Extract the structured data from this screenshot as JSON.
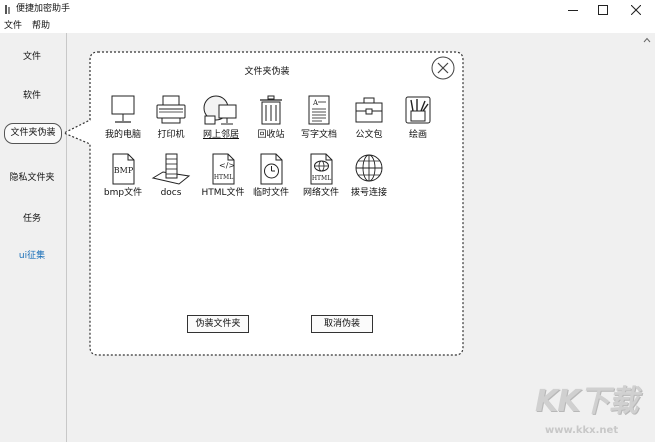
{
  "window": {
    "title": "便捷加密助手",
    "controls": [
      "minimize-icon",
      "maximize-icon",
      "close-icon"
    ]
  },
  "menubar": {
    "items": [
      "文件",
      "帮助"
    ]
  },
  "sidebar": {
    "items": [
      {
        "label": "文件",
        "state": "normal"
      },
      {
        "label": "软件",
        "state": "normal"
      },
      {
        "label": "文件夹伪装",
        "state": "active"
      },
      {
        "label": "隐私文件夹",
        "state": "normal"
      },
      {
        "label": "任务",
        "state": "normal"
      },
      {
        "label": "ui征集",
        "state": "link",
        "color": "#1a6fb8"
      }
    ]
  },
  "dialog": {
    "title": "文件夹伪装",
    "close_icon": "circle-close-icon",
    "tiles": [
      {
        "label": "我的电脑",
        "icon": "computer-icon"
      },
      {
        "label": "打印机",
        "icon": "printer-icon"
      },
      {
        "label": "网上邻居",
        "icon": "network-neighborhood-icon",
        "selected": true
      },
      {
        "label": "回收站",
        "icon": "recycle-bin-icon"
      },
      {
        "label": "写字文档",
        "icon": "text-document-icon"
      },
      {
        "label": "公文包",
        "icon": "briefcase-icon"
      },
      {
        "label": "绘画",
        "icon": "paint-icon"
      },
      {
        "label": "bmp文件",
        "icon": "bmp-file-icon",
        "badge": "BMP"
      },
      {
        "label": "docs",
        "icon": "docs-icon"
      },
      {
        "label": "HTML文件",
        "icon": "html-file-icon",
        "badge": "HTML"
      },
      {
        "label": "临时文件",
        "icon": "temp-file-icon"
      },
      {
        "label": "网络文件",
        "icon": "web-file-icon",
        "badge": "HTML"
      },
      {
        "label": "拨号连接",
        "icon": "dialup-globe-icon"
      }
    ],
    "buttons": {
      "confirm": "伪装文件夹",
      "cancel": "取消伪装"
    }
  },
  "watermark": {
    "logo": "KK下载",
    "url": "www.kkx.net"
  },
  "colors": {
    "window_bg": "#f0f0f0",
    "titlebar_bg": "#ffffff",
    "link": "#1a6fb8",
    "dialog_bg": "#ffffff"
  }
}
